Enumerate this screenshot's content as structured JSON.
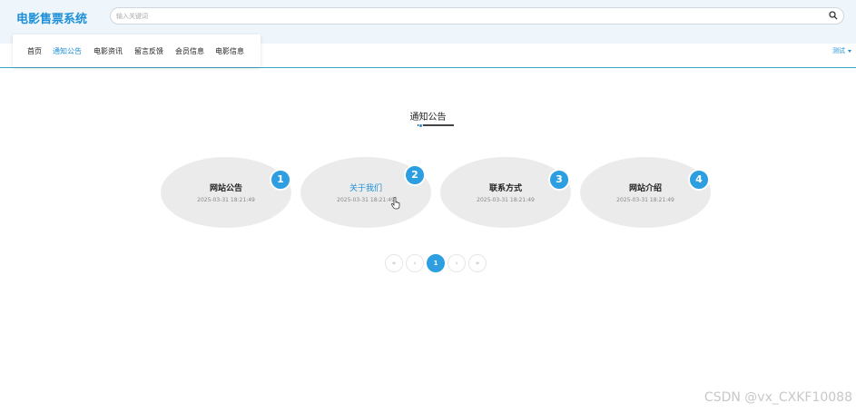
{
  "header": {
    "logo": "电影售票系统",
    "search_placeholder": "输入关键词",
    "search_icon": "search-icon"
  },
  "nav": {
    "items": [
      {
        "label": "首页",
        "active": false
      },
      {
        "label": "通知公告",
        "active": true
      },
      {
        "label": "电影资讯",
        "active": false
      },
      {
        "label": "留言反馈",
        "active": false
      },
      {
        "label": "会员信息",
        "active": false
      },
      {
        "label": "电影信息",
        "active": false
      }
    ],
    "user": "测试"
  },
  "section": {
    "title": "通知公告"
  },
  "cards": [
    {
      "number": "1",
      "title": "网站公告",
      "date": "2025-03-31 18:21:49"
    },
    {
      "number": "2",
      "title": "关于我们",
      "date": "2025-03-31 18:21:49"
    },
    {
      "number": "3",
      "title": "联系方式",
      "date": "2025-03-31 18:21:49"
    },
    {
      "number": "4",
      "title": "网站介绍",
      "date": "2025-03-31 18:21:49"
    }
  ],
  "pagination": {
    "first": "«",
    "prev": "‹",
    "current": "1",
    "next": "›",
    "last": "»"
  },
  "watermark": "CSDN @vx_CXKF10088",
  "colors": {
    "accent": "#1e90d8",
    "badge": "#2d9fe0",
    "card_bg": "#ebebeb",
    "header_bg": "#eef5fb"
  }
}
